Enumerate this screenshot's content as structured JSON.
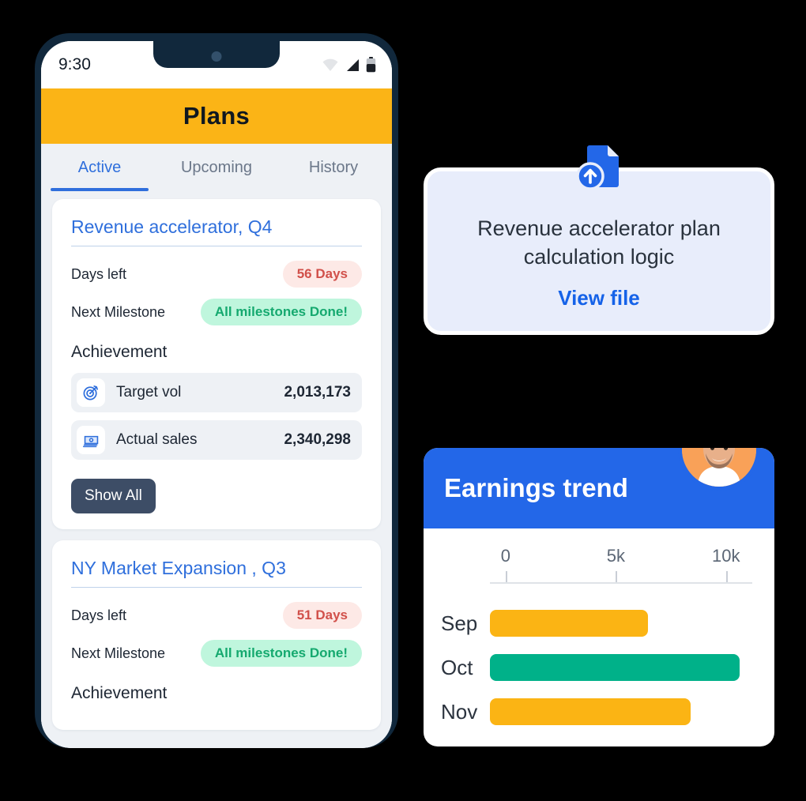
{
  "phone": {
    "status": {
      "time": "9:30",
      "icons": [
        "wifi-icon",
        "signal-icon",
        "battery-icon"
      ]
    },
    "appbar": {
      "title": "Plans"
    },
    "tabs": [
      {
        "label": "Active",
        "active": true
      },
      {
        "label": "Upcoming",
        "active": false
      },
      {
        "label": "History",
        "active": false
      }
    ],
    "plans": [
      {
        "title": "Revenue accelerator, Q4",
        "days_left_label": "Days left",
        "days_left_value": "56 Days",
        "milestone_label": "Next Milestone",
        "milestone_value": "All milestones Done!",
        "achievement_label": "Achievement",
        "metrics": [
          {
            "icon": "target-icon",
            "label": "Target vol",
            "value": "2,013,173"
          },
          {
            "icon": "money-icon",
            "label": "Actual sales",
            "value": "2,340,298"
          }
        ],
        "show_all_label": "Show All"
      },
      {
        "title": "NY Market Expansion , Q3",
        "days_left_label": "Days left",
        "days_left_value": "51 Days",
        "milestone_label": "Next Milestone",
        "milestone_value": "All milestones Done!",
        "achievement_label": "Achievement",
        "metrics": [],
        "show_all_label": ""
      }
    ]
  },
  "file_card": {
    "icon": "file-upload-icon",
    "title": "Revenue accelerator plan calculation logic",
    "link_label": "View file"
  },
  "earnings_card": {
    "title": "Earnings trend",
    "avatar": "user-avatar"
  },
  "chart_data": {
    "type": "bar",
    "orientation": "horizontal",
    "title": "Earnings trend",
    "categories": [
      "Sep",
      "Oct",
      "Nov"
    ],
    "values": [
      6500,
      10600,
      8400
    ],
    "bar_colors": [
      "#FBB414",
      "#00B189",
      "#FBB414"
    ],
    "xlabel": "",
    "ylabel": "",
    "xlim": [
      0,
      11000
    ],
    "ticks": [
      0,
      5000,
      10000
    ],
    "tick_labels": [
      "0",
      "5k",
      "10k"
    ],
    "grid": false,
    "legend": "none"
  },
  "colors": {
    "amber": "#FBB414",
    "green": "#00B189",
    "blue": "#2367E8",
    "link_blue": "#2F6FDC",
    "dark_slate": "#3D4D66",
    "bezel": "#11283C",
    "badge_pink_bg": "#FDE9E6",
    "badge_pink_text": "#D1504A",
    "badge_mint_bg": "#BFF6DD",
    "badge_mint_text": "#15A96F"
  }
}
